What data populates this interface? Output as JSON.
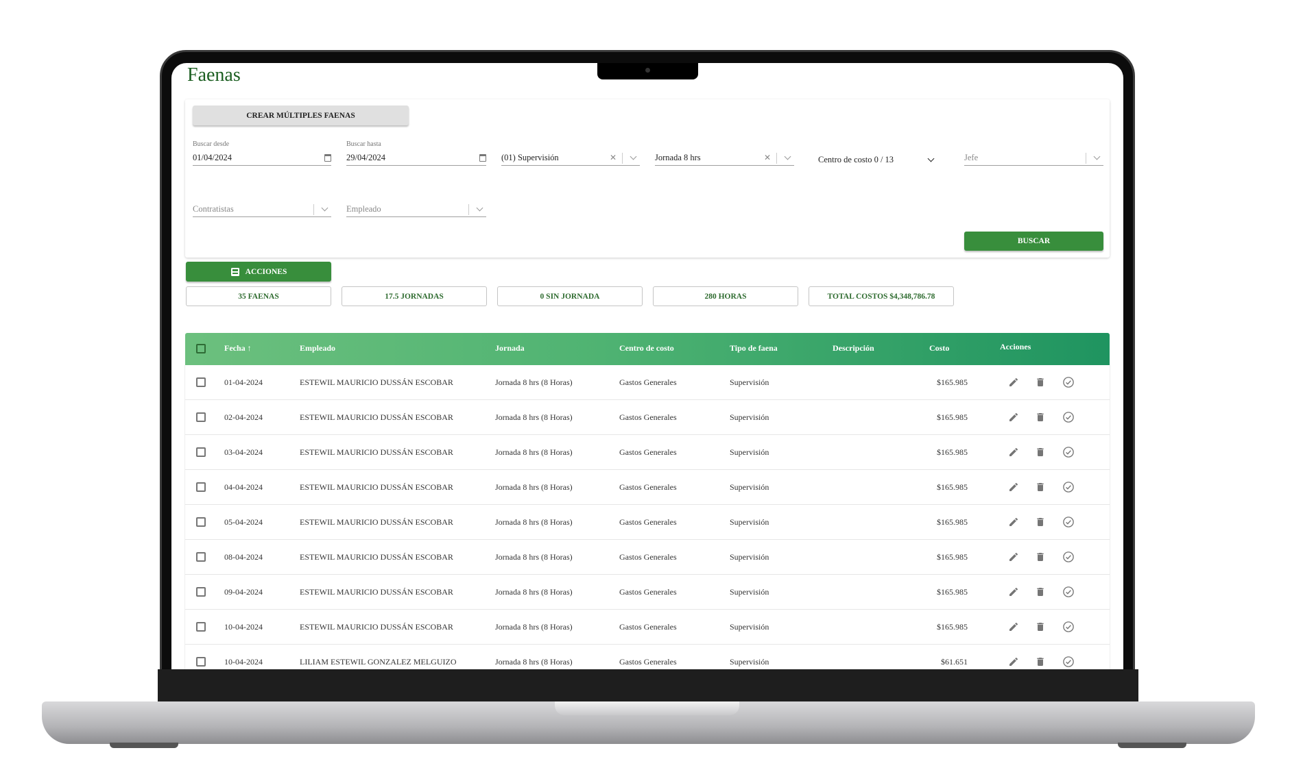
{
  "page": {
    "title": "Faenas"
  },
  "filters": {
    "crear_label": "CREAR MÚLTIPLES FAENAS",
    "desde_label": "Buscar desde",
    "desde_value": "01/04/2024",
    "hasta_label": "Buscar hasta",
    "hasta_value": "29/04/2024",
    "tipo_value": "(01) Supervisión",
    "jornada_value": "Jornada 8 hrs",
    "centro_value": "Centro de costo 0 / 13",
    "jefe_placeholder": "Jefe",
    "contratistas_placeholder": "Contratistas",
    "empleado_placeholder": "Empleado",
    "buscar_label": "BUSCAR"
  },
  "acciones_label": "ACCIONES",
  "summary": [
    "35 FAENAS",
    "17.5 JORNADAS",
    "0 SIN JORNADA",
    "280 HORAS",
    "TOTAL COSTOS $4,348,786.78"
  ],
  "table": {
    "sort": {
      "column": "Fecha",
      "direction": "asc"
    },
    "headers": {
      "fecha": "Fecha",
      "empleado": "Empleado",
      "jornada": "Jornada",
      "centro": "Centro de costo",
      "tipo": "Tipo de faena",
      "descripcion": "Descripción",
      "costo": "Costo",
      "acciones": "Acciones"
    },
    "rows": [
      {
        "fecha": "01-04-2024",
        "empleado": "ESTEWIL MAURICIO DUSSÁN ESCOBAR",
        "jornada": "Jornada 8 hrs (8 Horas)",
        "centro": "Gastos Generales",
        "tipo": "Supervisión",
        "descripcion": "",
        "costo": "$165.985"
      },
      {
        "fecha": "02-04-2024",
        "empleado": "ESTEWIL MAURICIO DUSSÁN ESCOBAR",
        "jornada": "Jornada 8 hrs (8 Horas)",
        "centro": "Gastos Generales",
        "tipo": "Supervisión",
        "descripcion": "",
        "costo": "$165.985"
      },
      {
        "fecha": "03-04-2024",
        "empleado": "ESTEWIL MAURICIO DUSSÁN ESCOBAR",
        "jornada": "Jornada 8 hrs (8 Horas)",
        "centro": "Gastos Generales",
        "tipo": "Supervisión",
        "descripcion": "",
        "costo": "$165.985"
      },
      {
        "fecha": "04-04-2024",
        "empleado": "ESTEWIL MAURICIO DUSSÁN ESCOBAR",
        "jornada": "Jornada 8 hrs (8 Horas)",
        "centro": "Gastos Generales",
        "tipo": "Supervisión",
        "descripcion": "",
        "costo": "$165.985"
      },
      {
        "fecha": "05-04-2024",
        "empleado": "ESTEWIL MAURICIO DUSSÁN ESCOBAR",
        "jornada": "Jornada 8 hrs (8 Horas)",
        "centro": "Gastos Generales",
        "tipo": "Supervisión",
        "descripcion": "",
        "costo": "$165.985"
      },
      {
        "fecha": "08-04-2024",
        "empleado": "ESTEWIL MAURICIO DUSSÁN ESCOBAR",
        "jornada": "Jornada 8 hrs (8 Horas)",
        "centro": "Gastos Generales",
        "tipo": "Supervisión",
        "descripcion": "",
        "costo": "$165.985"
      },
      {
        "fecha": "09-04-2024",
        "empleado": "ESTEWIL MAURICIO DUSSÁN ESCOBAR",
        "jornada": "Jornada 8 hrs (8 Horas)",
        "centro": "Gastos Generales",
        "tipo": "Supervisión",
        "descripcion": "",
        "costo": "$165.985"
      },
      {
        "fecha": "10-04-2024",
        "empleado": "ESTEWIL MAURICIO DUSSÁN ESCOBAR",
        "jornada": "Jornada 8 hrs (8 Horas)",
        "centro": "Gastos Generales",
        "tipo": "Supervisión",
        "descripcion": "",
        "costo": "$165.985"
      },
      {
        "fecha": "10-04-2024",
        "empleado": "LILIAM ESTEWIL GONZALEZ MELGUIZO",
        "jornada": "Jornada 8 hrs (8 Horas)",
        "centro": "Gastos Generales",
        "tipo": "Supervisión",
        "descripcion": "",
        "costo": "$61.651"
      }
    ]
  },
  "colors": {
    "brand_green": "#388e3c",
    "title_green": "#1b5e20",
    "header_gradient_start": "#6cc07e",
    "header_gradient_end": "#1f9460"
  }
}
